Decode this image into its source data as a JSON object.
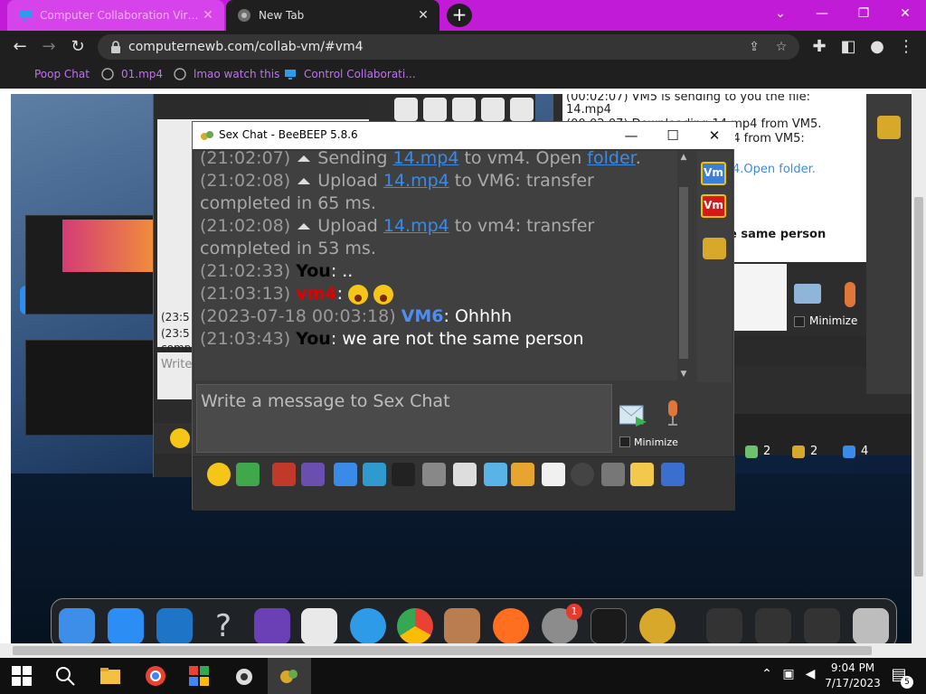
{
  "browser": {
    "tabs": [
      {
        "title": "Computer Collaboration Virtual Ma...",
        "active": true
      },
      {
        "title": "New Tab",
        "active": false
      }
    ],
    "url": "computernewb.com/collab-vm/#vm4",
    "bookmarks": [
      "Poop Chat",
      "01.mp4",
      "lmao watch this",
      "Control Collaborati..."
    ]
  },
  "bg_windows": {
    "right_chat_lines": [
      "(00:02:07)   VM5 is sending to you the file:",
      "14.mp4",
      "(00:02:07)   Downloading 14.mp4 from VM5.",
      "p4 from VM5:",
      "4.Open folder.",
      "e same person"
    ],
    "right_minimize_label": "Minimize",
    "status_counts": [
      "2",
      "2",
      "4"
    ],
    "back_chat_lines": [
      "(23:5",
      "(23:5",
      "comp",
      "Write"
    ]
  },
  "bee": {
    "title": "Sex Chat - BeeBEEP 5.8.6",
    "input_placeholder": "Write a message to Sex Chat",
    "minimize_label": "Minimize",
    "badges": [
      "Vm",
      "Vm"
    ],
    "messages": [
      {
        "ts": "(21:02:07)",
        "pre": " Sending ",
        "link": "14.mp4",
        "mid": " to vm4. Open ",
        "link2": "folder",
        "post": "."
      },
      {
        "ts": "(21:02:08)",
        "pre": " Upload ",
        "link": "14.mp4",
        "post": " to VM6: transfer",
        "cont": "completed in 65 ms."
      },
      {
        "ts": "(21:02:08)",
        "pre": " Upload ",
        "link": "14.mp4",
        "post": " to vm4: transfer",
        "cont": "completed in 53 ms."
      },
      {
        "ts": "(21:02:33)",
        "sender": "You",
        "text": ": .."
      },
      {
        "ts": "(21:03:13)",
        "sender": "vm4",
        "text": ":"
      },
      {
        "ts": "(2023-07-18 00:03:18)",
        "sender": "VM6",
        "text": ": Ohhhh"
      },
      {
        "ts": "(21:03:43)",
        "sender": "You",
        "text": ": we are not the same person"
      }
    ]
  },
  "dock": {
    "notification_count": "1"
  },
  "taskbar": {
    "time": "9:04 PM",
    "date": "7/17/2023",
    "notification_count": "5"
  },
  "colors": {
    "tab_strip": "#c21bd8",
    "link": "#3a8be8",
    "you": "#000000",
    "vm4": "#e00000",
    "vm6": "#4f8df0"
  }
}
